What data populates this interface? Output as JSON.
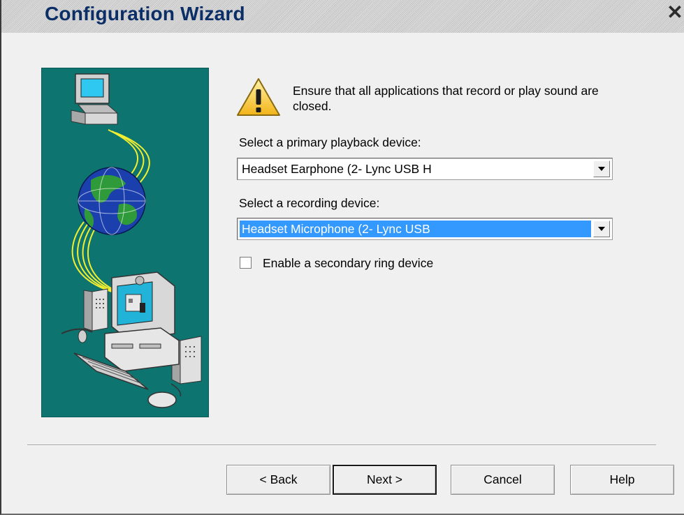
{
  "window": {
    "title": "Configuration Wizard",
    "close_glyph": "✕"
  },
  "warning": {
    "icon": "warning-triangle-icon",
    "text": "Ensure that all applications that record or play sound are closed."
  },
  "playback": {
    "label": "Select a primary playback device:",
    "value": "Headset Earphone (2- Lync USB H"
  },
  "recording": {
    "label": "Select a recording device:",
    "value": "Headset Microphone (2- Lync USB"
  },
  "secondary_ring": {
    "label": "Enable a secondary ring device",
    "checked": false
  },
  "buttons": {
    "back": "< Back",
    "next": "Next >",
    "cancel": "Cancel",
    "help": "Help"
  },
  "colors": {
    "title_text": "#0b2e66",
    "illustration_bg": "#0d7470",
    "selection": "#3399ff",
    "warning_yellow": "#f5c518"
  }
}
